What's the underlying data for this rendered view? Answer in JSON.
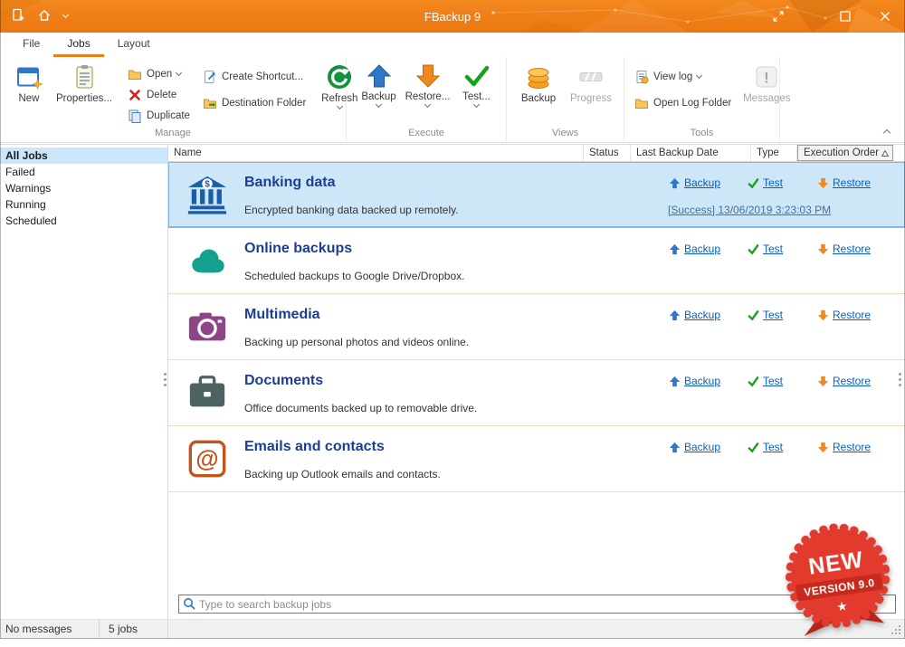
{
  "window": {
    "title": "FBackup 9"
  },
  "colors": {
    "titlebar_orange": "#EC7710",
    "accent_orange": "#E87E17",
    "link_blue": "#0A5FC2",
    "job_title_blue": "#1C3E94",
    "selection_blue": "#CDE7F8",
    "badge_red": "#E23B2E",
    "success_link_blue": "#44719E"
  },
  "tabs": [
    {
      "label": "File"
    },
    {
      "label": "Jobs",
      "active": true
    },
    {
      "label": "Layout"
    }
  ],
  "ribbon": {
    "manage": {
      "label": "Manage",
      "new": "New",
      "properties": "Properties...",
      "open": "Open",
      "delete": "Delete",
      "duplicate": "Duplicate",
      "create_shortcut": "Create Shortcut...",
      "destination_folder": "Destination Folder",
      "refresh": "Refresh"
    },
    "execute": {
      "label": "Execute",
      "backup": "Backup",
      "restore": "Restore...",
      "test": "Test..."
    },
    "views": {
      "label": "Views",
      "backup": "Backup",
      "progress": "Progress"
    },
    "tools": {
      "label": "Tools",
      "view_log": "View log",
      "open_log_folder": "Open Log Folder",
      "messages": "Messages"
    }
  },
  "sidebar": {
    "items": [
      {
        "label": "All Jobs",
        "selected": true
      },
      {
        "label": "Failed"
      },
      {
        "label": "Warnings"
      },
      {
        "label": "Running"
      },
      {
        "label": "Scheduled"
      }
    ]
  },
  "table": {
    "columns": [
      {
        "label": "Name"
      },
      {
        "label": "Status"
      },
      {
        "label": "Last Backup Date"
      },
      {
        "label": "Type"
      },
      {
        "label": "Execution Order",
        "sort": "asc"
      }
    ],
    "actions": {
      "backup": "Backup",
      "test": "Test",
      "restore": "Restore"
    },
    "rows": [
      {
        "icon": "bank-icon",
        "name": "Banking data",
        "description": "Encrypted banking data backed up remotely.",
        "last_backup": "[Success] 13/06/2019 3:23:03 PM",
        "selected": true
      },
      {
        "icon": "cloud-icon",
        "name": "Online backups",
        "description": "Scheduled backups to Google Drive/Dropbox."
      },
      {
        "icon": "camera-icon",
        "name": "Multimedia",
        "description": "Backing up personal photos and videos online."
      },
      {
        "icon": "briefcase-icon",
        "name": "Documents",
        "description": "Office documents backed up to removable drive."
      },
      {
        "icon": "email-at-icon",
        "name": "Emails and contacts",
        "description": "Backing up Outlook emails and contacts."
      }
    ]
  },
  "search": {
    "placeholder": "Type to search backup jobs"
  },
  "statusbar": {
    "messages": "No messages",
    "jobs": "5 jobs"
  },
  "badge": {
    "line1": "NEW",
    "line2": "VERSION 9.0",
    "star": "★"
  },
  "glyphs": {
    "bank_symbol": "$",
    "email_symbol": "@",
    "messages_symbol": "!"
  }
}
